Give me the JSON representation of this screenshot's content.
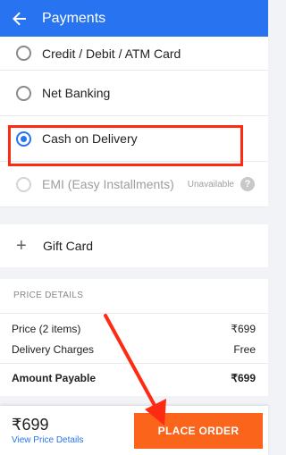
{
  "header": {
    "title": "Payments"
  },
  "payment_options": [
    {
      "label": "Credit / Debit / ATM Card",
      "selected": false,
      "disabled": false
    },
    {
      "label": "Net Banking",
      "selected": false,
      "disabled": false
    },
    {
      "label": "Cash on Delivery",
      "selected": true,
      "disabled": false
    },
    {
      "label": "EMI (Easy Installments)",
      "selected": false,
      "disabled": true,
      "status": "Unavailable"
    }
  ],
  "gift_card": {
    "label": "Gift Card"
  },
  "price_details": {
    "heading": "PRICE DETAILS",
    "rows": [
      {
        "label": "Price (2 items)",
        "value": "₹699"
      },
      {
        "label": "Delivery Charges",
        "value": "Free"
      }
    ],
    "total": {
      "label": "Amount Payable",
      "value": "₹699"
    }
  },
  "footer": {
    "amount": "₹699",
    "view_details": "View Price Details",
    "place_order": "PLACE ORDER"
  },
  "colors": {
    "primary": "#2874f0",
    "cta": "#fb641b",
    "annotation": "#ff2a12"
  }
}
